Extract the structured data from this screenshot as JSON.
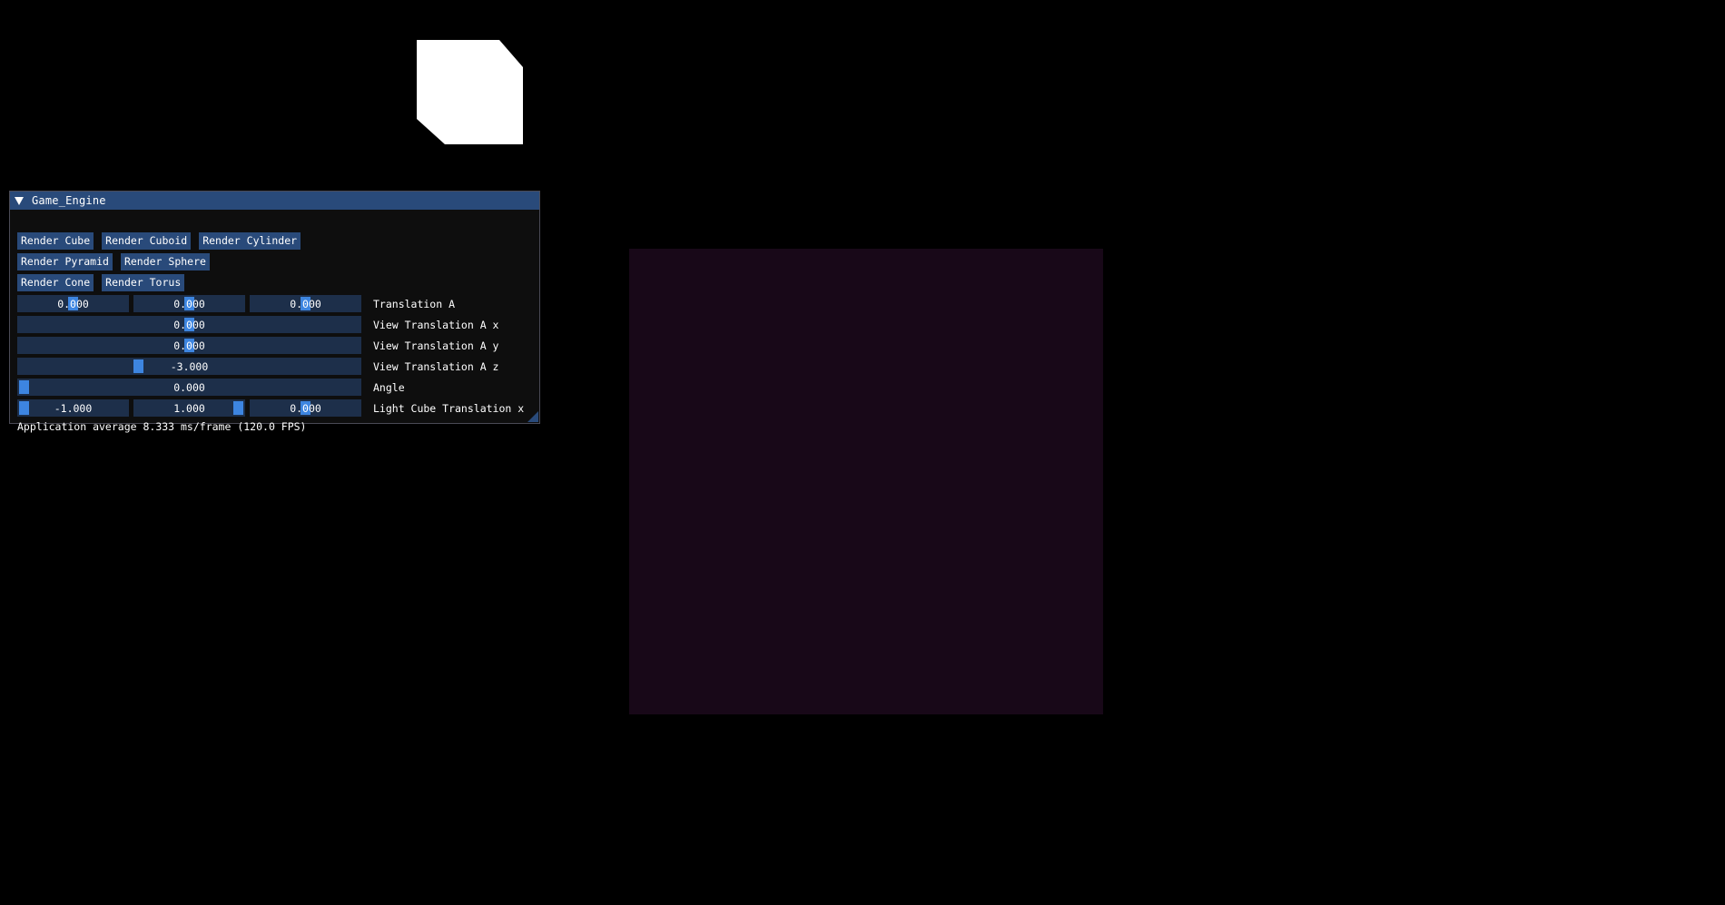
{
  "window": {
    "title": "Game_Engine",
    "collapse_icon": "triangle-down-icon"
  },
  "buttons": {
    "row1": [
      "Render Cube",
      "Render Cuboid",
      "Render Cylinder"
    ],
    "row2": [
      "Render Pyramid",
      "Render Sphere"
    ],
    "row3": [
      "Render Cone",
      "Render Torus"
    ]
  },
  "sliders": {
    "translation_a": {
      "label": "Translation A",
      "values": [
        "0.000",
        "0.000",
        "0.000"
      ]
    },
    "view_translation_x": {
      "label": "View Translation A x",
      "value": "0.000"
    },
    "view_translation_y": {
      "label": "View Translation A y",
      "value": "0.000"
    },
    "view_translation_z": {
      "label": "View Translation A z",
      "value": "-3.000"
    },
    "angle": {
      "label": "Angle",
      "value": "0.000"
    },
    "light_cube_translation": {
      "label": "Light Cube Translation x",
      "values": [
        "-1.000",
        "1.000",
        "0.000"
      ]
    }
  },
  "stats": {
    "fps_text": "Application average 8.333 ms/frame (120.0 FPS)"
  },
  "colors": {
    "title_bar": "#294a7a",
    "button": "#294a7a",
    "frame_bg": "#1d2f4a",
    "grab": "#3d85e0",
    "window_bg": "#0f0f0f",
    "light_cube": "#ffffff",
    "render_quad": "#180818"
  }
}
